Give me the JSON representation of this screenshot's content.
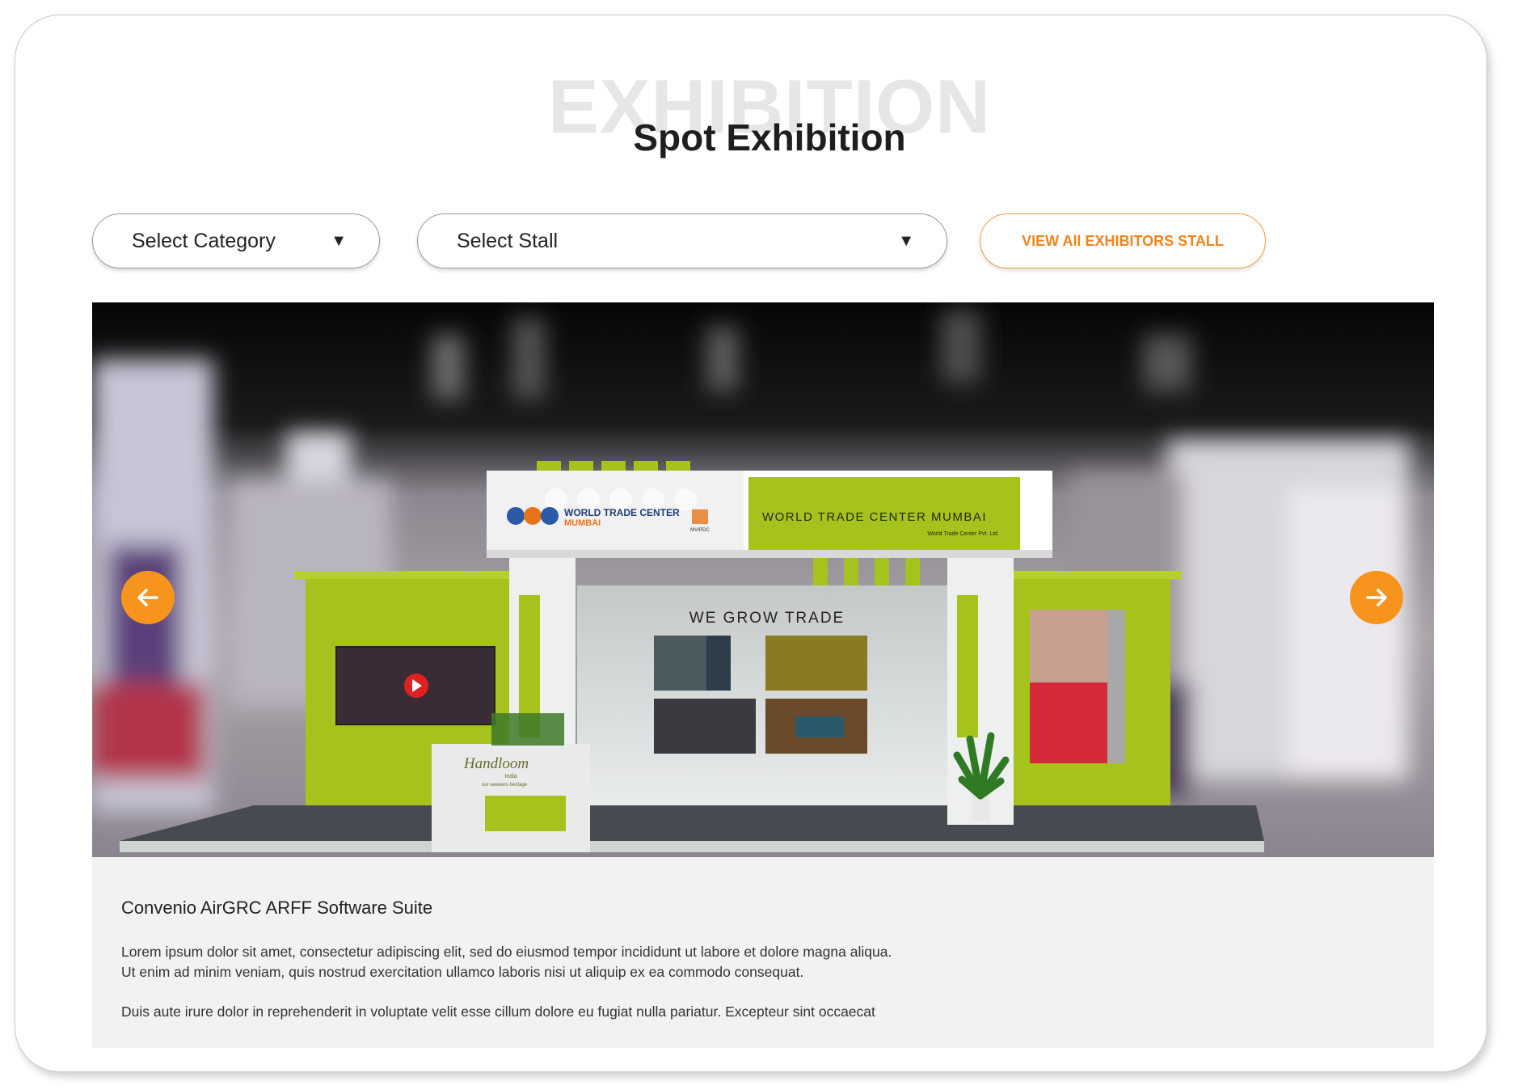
{
  "header": {
    "watermark": "EXHIBITION",
    "title": "Spot Exhibition"
  },
  "filters": {
    "category_label": "Select Category",
    "stall_label": "Select Stall",
    "view_all_label": "VIEW All EXHIBITORS STALL"
  },
  "stall_scene": {
    "brand_name": "WORLD TRADE CENTER",
    "brand_city": "MUMBAI",
    "brand_mark": "MVIRDC",
    "banner_title": "WORLD TRADE CENTER MUMBAI",
    "banner_subtitle": "World Trade Center Pvt. Ltd.",
    "wall_slogan": "WE GROW TRADE",
    "desk_logo": "Handloom",
    "desk_logo_sub": "India",
    "desk_logo_tag": "our weavers heritage"
  },
  "carousel": {
    "prev_icon": "arrow-left-icon",
    "next_icon": "arrow-right-icon",
    "accent_color": "#f7941d"
  },
  "exhibitor": {
    "name": "Convenio AirGRC ARFF Software Suite",
    "desc_line1": "Lorem ipsum dolor sit amet, consectetur adipiscing elit, sed do eiusmod tempor incididunt ut labore et dolore magna aliqua.",
    "desc_line2": "Ut enim ad minim veniam, quis nostrud exercitation ullamco laboris nisi ut aliquip ex ea commodo consequat.",
    "desc_line3": "Duis aute irure dolor in reprehenderit in voluptate velit esse cillum dolore eu fugiat nulla pariatur. Excepteur sint occaecat"
  },
  "colors": {
    "accent": "#f0831e",
    "stall_green": "#a6c21c"
  }
}
